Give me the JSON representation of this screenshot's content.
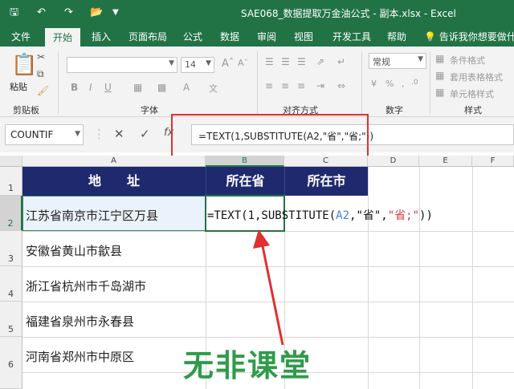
{
  "window": {
    "title": "SAE068_数据提取万金油公式 - 副本.xlsx  -  Excel",
    "qa_icons": [
      "save-icon",
      "undo-icon",
      "redo-icon",
      "open-icon",
      "customize-icon"
    ]
  },
  "tabs": [
    {
      "label": "文件",
      "active": false
    },
    {
      "label": "开始",
      "active": true
    },
    {
      "label": "插入",
      "active": false
    },
    {
      "label": "页面布局",
      "active": false
    },
    {
      "label": "公式",
      "active": false
    },
    {
      "label": "数据",
      "active": false
    },
    {
      "label": "审阅",
      "active": false
    },
    {
      "label": "视图",
      "active": false
    },
    {
      "label": "开发工具",
      "active": false
    },
    {
      "label": "帮助",
      "active": false
    }
  ],
  "tell_me": "告诉我你想要做什么",
  "ribbon": {
    "clipboard_label": "剪贴板",
    "paste_label": "粘贴",
    "font_label": "字体",
    "font_size": "14",
    "align_label": "对齐方式",
    "number_label": "数字",
    "number_format": "常规",
    "styles_label": "样式",
    "conditional_format": "条件格式",
    "table_format": "套用表格格式",
    "cell_styles": "单元格样式"
  },
  "formula_bar": {
    "name_box": "COUNTIF",
    "formula": "=TEXT(1,SUBSTITUTE(A2,\"省\",\"省;\"))"
  },
  "columns": [
    "A",
    "B",
    "C",
    "D",
    "E",
    "F"
  ],
  "rows": [
    "1",
    "2",
    "3",
    "4",
    "5",
    "6"
  ],
  "header_row": {
    "address": "地　　址",
    "province": "所在省",
    "city": "所在市"
  },
  "addresses": [
    "江苏省南京市江宁区万县",
    "安徽省黄山市歙县",
    "浙江省杭州市千岛湖市",
    "福建省泉州市永春县",
    "河南省郑州市中原区"
  ],
  "cell_formula": {
    "prefix": "=TEXT(1,SUBSTITUTE(",
    "ref": "A2",
    "mid": ",\"省\",",
    "arg": "\"省;\"",
    "suffix": "))"
  },
  "watermark": "无非课堂",
  "colors": {
    "excel_green": "#217346",
    "header_navy": "#1f2a6e",
    "annotation_red": "#e03030",
    "watermark_green": "#2f9b4a"
  }
}
